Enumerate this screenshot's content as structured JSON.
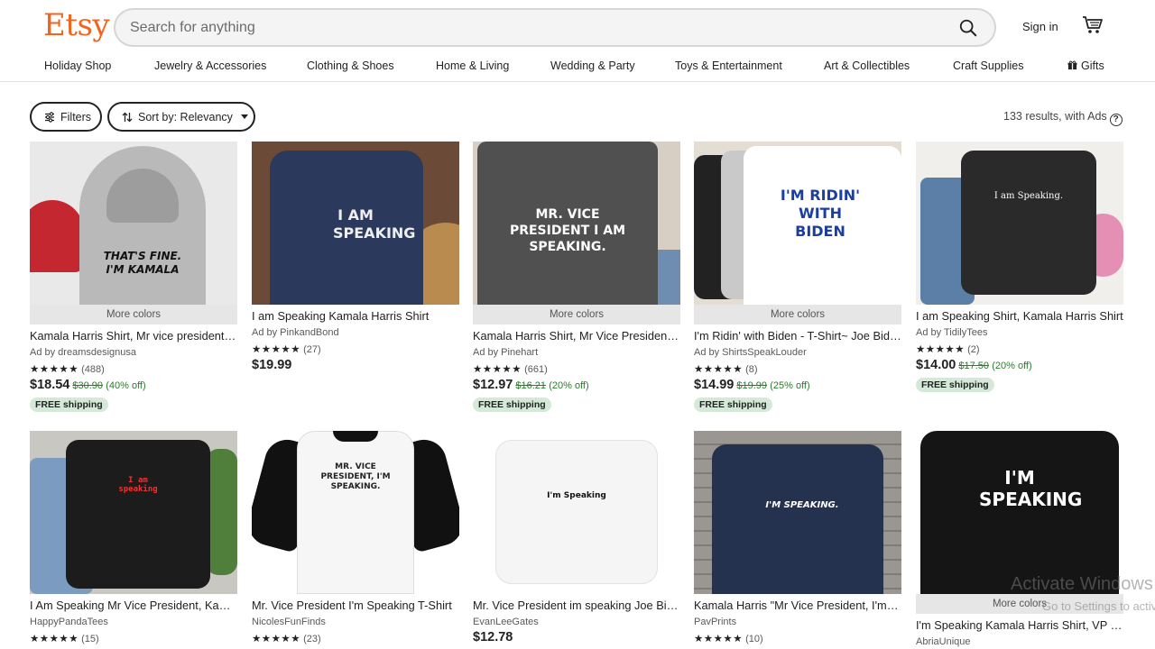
{
  "header": {
    "logo": "Etsy",
    "search_placeholder": "Search for anything",
    "signin": "Sign in"
  },
  "nav": {
    "items": [
      "Holiday Shop",
      "Jewelry & Accessories",
      "Clothing & Shoes",
      "Home & Living",
      "Wedding & Party",
      "Toys & Entertainment",
      "Art & Collectibles",
      "Craft Supplies",
      "Gifts"
    ]
  },
  "toolbar": {
    "filters_label": "Filters",
    "sort_label": "Sort by: Relevancy",
    "results_text": "133 results, with Ads"
  },
  "listings": [
    {
      "title": "Kamala Harris Shirt, Mr vice president I'm speaking",
      "seller": "Ad by dreamsdesignusa",
      "stars": "★★★★★",
      "reviews": "(488)",
      "price": "$18.54",
      "original": "$30.90",
      "discount": "(40% off)",
      "free_shipping": "FREE shipping",
      "more_colors": "More colors",
      "shirt_text": "THAT'S FINE. I'M KAMALA"
    },
    {
      "title": "I am Speaking Kamala Harris Shirt",
      "seller": "Ad by PinkandBond",
      "stars": "★★★★★",
      "reviews": "(27)",
      "price": "$19.99",
      "original": "",
      "discount": "",
      "free_shipping": "",
      "more_colors": "",
      "shirt_text": "I AM SPEAKING"
    },
    {
      "title": "Kamala Harris Shirt, Mr Vice President I Am Speaking",
      "seller": "Ad by Pinehart",
      "stars": "★★★★★",
      "reviews": "(661)",
      "price": "$12.97",
      "original": "$16.21",
      "discount": "(20% off)",
      "free_shipping": "FREE shipping",
      "more_colors": "More colors",
      "shirt_text": "MR. VICE PRESIDENT I AM SPEAKING."
    },
    {
      "title": "I'm Ridin' with Biden - T-Shirt~ Joe Biden Shirt",
      "seller": "Ad by ShirtsSpeakLouder",
      "stars": "★★★★★",
      "reviews": "(8)",
      "price": "$14.99",
      "original": "$19.99",
      "discount": "(25% off)",
      "free_shipping": "FREE shipping",
      "more_colors": "More colors",
      "shirt_text": "I'M RIDIN' WITH BIDEN"
    },
    {
      "title": "I am Speaking Shirt, Kamala Harris Shirt",
      "seller": "Ad by TidilyTees",
      "stars": "★★★★★",
      "reviews": "(2)",
      "price": "$14.00",
      "original": "$17.50",
      "discount": "(20% off)",
      "free_shipping": "FREE shipping",
      "more_colors": "",
      "shirt_text": "I am Speaking."
    },
    {
      "title": "I Am Speaking Mr Vice President, Kamala Harris",
      "seller": "HappyPandaTees",
      "stars": "★★★★★",
      "reviews": "(15)",
      "price": "",
      "original": "",
      "discount": "",
      "free_shipping": "",
      "more_colors": "",
      "shirt_text": "I am speaking"
    },
    {
      "title": "Mr. Vice President I'm Speaking T-Shirt",
      "seller": "NicolesFunFinds",
      "stars": "★★★★★",
      "reviews": "(23)",
      "price": "",
      "original": "",
      "discount": "",
      "free_shipping": "",
      "more_colors": "",
      "shirt_text": "MR. VICE PRESIDENT, I'M SPEAKING."
    },
    {
      "title": "Mr. Vice President im speaking Joe Biden",
      "seller": "EvanLeeGates",
      "stars": "",
      "reviews": "",
      "price": "$12.78",
      "original": "",
      "discount": "",
      "free_shipping": "",
      "more_colors": "",
      "shirt_text": "I'm Speaking"
    },
    {
      "title": "Kamala Harris \"Mr Vice President, I'm Speaking\"",
      "seller": "PavPrints",
      "stars": "★★★★★",
      "reviews": "(10)",
      "price": "",
      "original": "",
      "discount": "",
      "free_shipping": "",
      "more_colors": "",
      "shirt_text": "I'M SPEAKING."
    },
    {
      "title": "I'm Speaking Kamala Harris Shirt, VP Debate",
      "seller": "AbriaUnique",
      "stars": "",
      "reviews": "",
      "price": "",
      "original": "",
      "discount": "",
      "free_shipping": "",
      "more_colors": "More colors",
      "shirt_text": "I'M SPEAKING"
    }
  ],
  "overlay": {
    "watermark_line1": "Activate Windows",
    "watermark_line2": "Go to Settings to activate"
  },
  "colors": {
    "brand": "#f1641e",
    "discount_green": "#2c7a2c",
    "shipping_badge": "#d4e9d7"
  }
}
